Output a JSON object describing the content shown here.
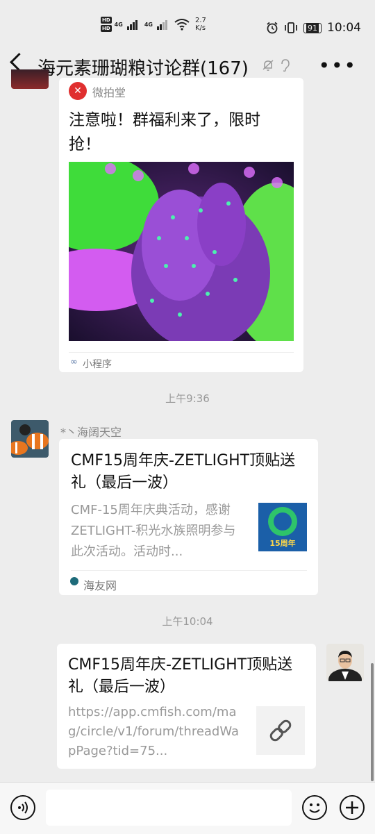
{
  "status_bar": {
    "hd_badge_1": "HD",
    "hd_badge_2": "HD",
    "network_1": "4G",
    "network_2": "4G",
    "speed_value": "2.7",
    "speed_unit": "K/s",
    "battery": "91",
    "time": "10:04"
  },
  "header": {
    "title": "海元素珊瑚粮讨论群(167)"
  },
  "messages": {
    "m1": {
      "source_name": "微拍堂",
      "headline": "注意啦！群福利来了，限时抢！",
      "footer": "小程序"
    },
    "time_1": "上午9:36",
    "m2": {
      "sender": "*丶海阔天空",
      "title": "CMF15周年庆-ZETLIGHT顶贴送礼（最后一波）",
      "desc": "CMF-15周年庆典活动，感谢ZETLIGHT-积光水族照明参与此次活动。活动时...",
      "thumb_text": "15周年",
      "footer": "海友网"
    },
    "time_2": "上午10:04",
    "m3": {
      "title": "CMF15周年庆-ZETLIGHT顶贴送礼（最后一波）",
      "url": "https://app.cmfish.com/mag/circle/v1/forum/threadWapPage?tid=75..."
    }
  },
  "colors": {
    "background": "#ededed",
    "coral_purple": "#8a3fc6",
    "coral_green": "#3fdc3a",
    "thumb_blue": "#1b5fa8"
  }
}
